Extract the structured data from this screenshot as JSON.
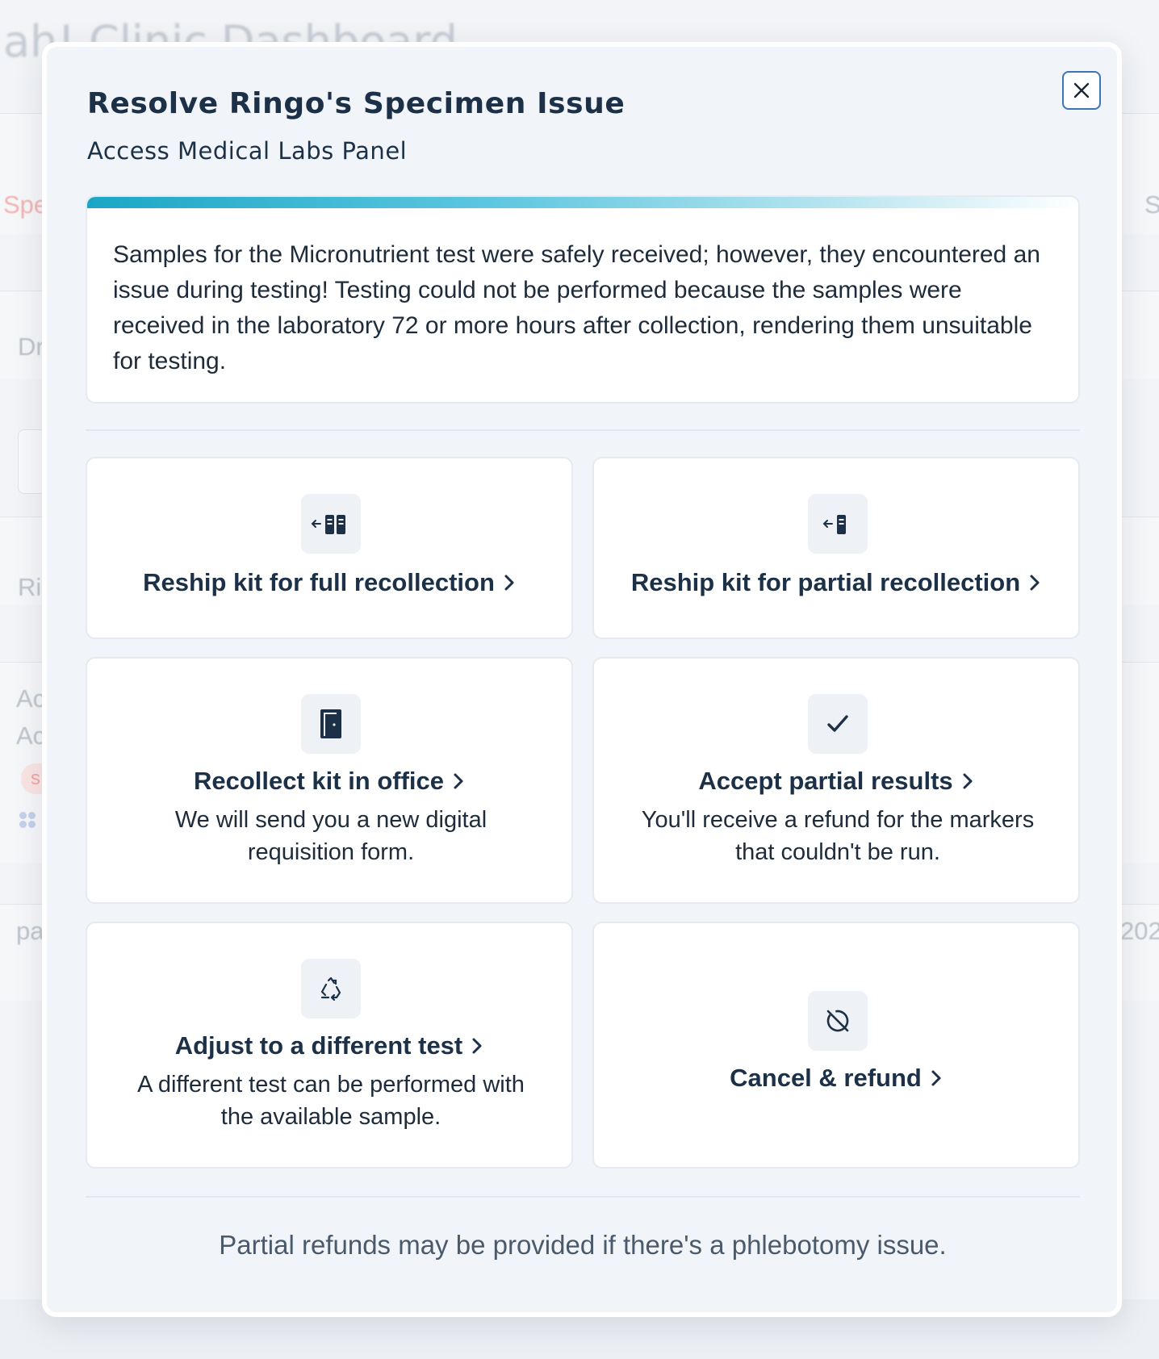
{
  "background": {
    "title_fragment": "ah! Clinic Dashboard",
    "fragments": [
      "Spe",
      "S",
      "Dr",
      "Ri",
      "Ac",
      "Ac",
      "pa",
      "202"
    ],
    "pill": "s"
  },
  "modal": {
    "title": "Resolve Ringo's Specimen Issue",
    "subtitle": "Access Medical Labs Panel",
    "close_icon": "close-icon",
    "info_text": "Samples for the Micronutrient test were safely received; however, they encountered an issue during testing! Testing could not be performed because the samples were received in the laboratory 72 or more hours after collection, rendering them unsuitable for testing.",
    "options": [
      {
        "title": "Reship kit for full recollection",
        "description": "",
        "icon": "reship-full-kit-icon"
      },
      {
        "title": "Reship kit for partial recollection",
        "description": "",
        "icon": "reship-partial-kit-icon"
      },
      {
        "title": "Recollect kit in office",
        "description": "We will send you a new digital requisition form.",
        "icon": "door-icon"
      },
      {
        "title": "Accept partial results",
        "description": "You'll receive a refund for the markers that couldn't be run.",
        "icon": "check-icon"
      },
      {
        "title": "Adjust to a different test",
        "description": "A different test can be performed with the available sample.",
        "icon": "recycle-icon"
      },
      {
        "title": "Cancel & refund",
        "description": "",
        "icon": "cancel-icon"
      }
    ],
    "footer_note": "Partial refunds may be provided if there's a phlebotomy issue."
  },
  "colors": {
    "primary_text": "#1c3147",
    "accent_blue": "#3a74b9",
    "progress_teal": "#1ba6c6",
    "modal_bg": "#f1f4f9"
  }
}
